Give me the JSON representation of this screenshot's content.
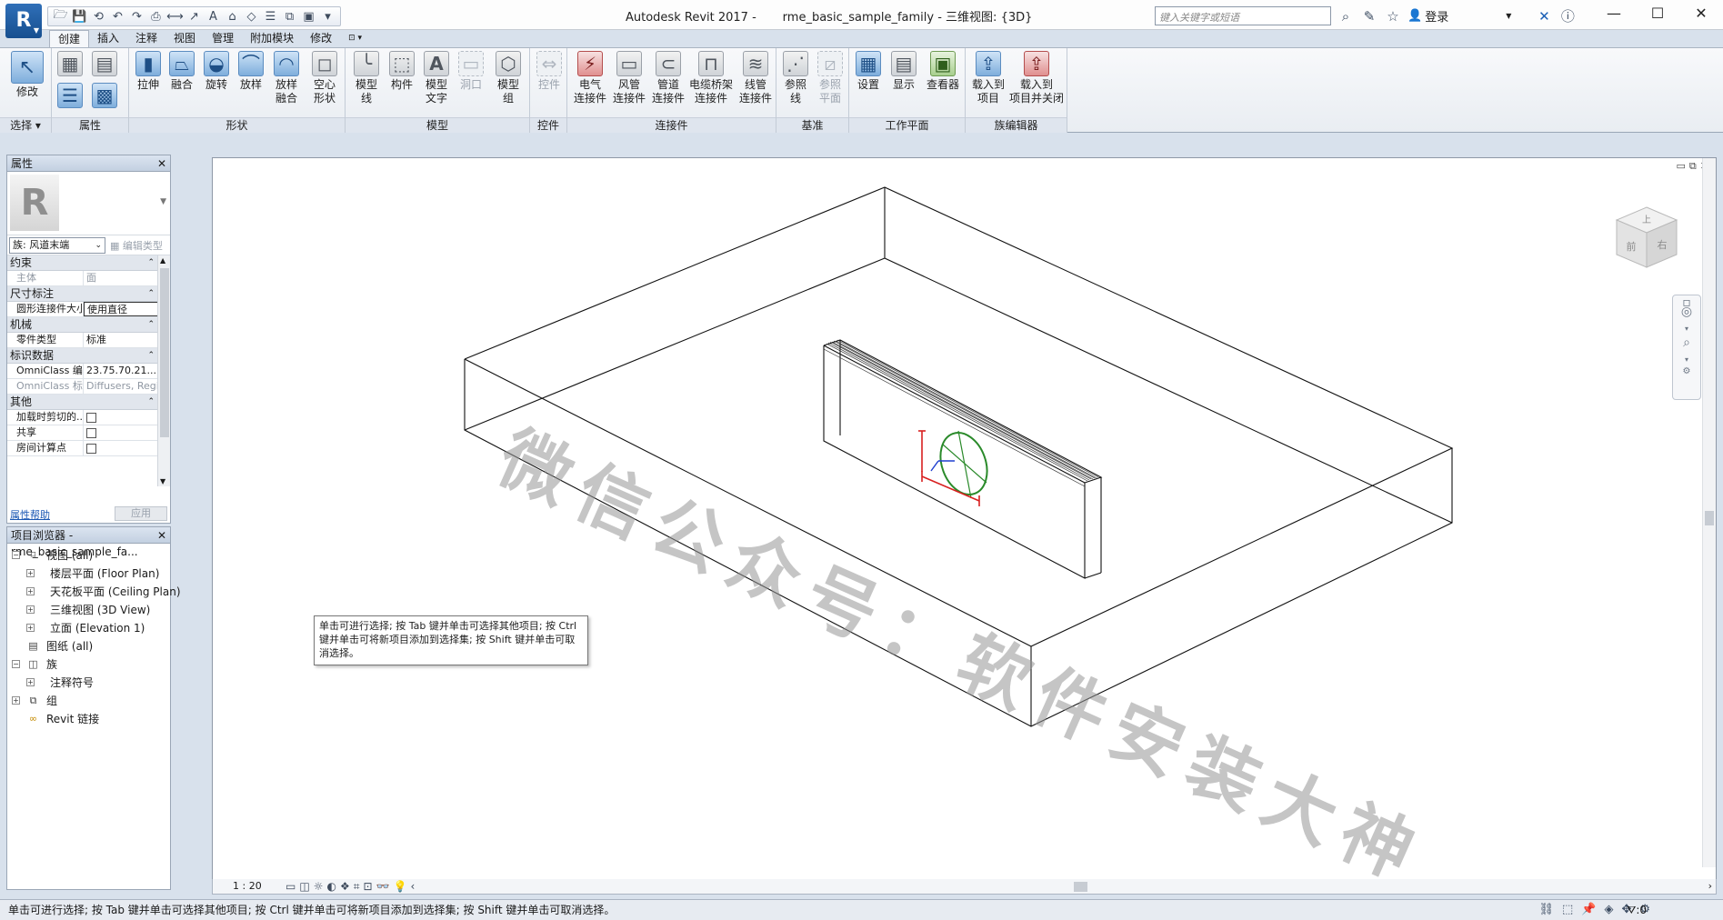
{
  "app": {
    "button_label": "R",
    "window_title": "Autodesk Revit 2017 -       rme_basic_sample_family - 三维视图: {3D}"
  },
  "infocenter": {
    "search_placeholder": "键入关键字或短语",
    "signin": "登录"
  },
  "ribbon": {
    "tabs": [
      "创建",
      "插入",
      "注释",
      "视图",
      "管理",
      "附加模块",
      "修改"
    ],
    "active_tab": "创建",
    "groups": {
      "select": "选择",
      "properties": "属性",
      "forms": "形状",
      "model": "模型",
      "control": "控件",
      "connectors": "连接件",
      "datum": "基准",
      "work_plane": "工作平面",
      "family_editor": "族编辑器"
    },
    "buttons": {
      "modify": "修改",
      "extrusion": "拉伸",
      "blend": "融合",
      "revolve": "旋转",
      "sweep": "放样",
      "swept_blend_1": "放样",
      "swept_blend_2": "融合",
      "void_1": "空心",
      "void_2": "形状",
      "model_line_1": "模型",
      "model_line_2": "线",
      "component": "构件",
      "model_text_1": "模型",
      "model_text_2": "文字",
      "opening": "洞口",
      "model_group_1": "模型",
      "model_group_2": "组",
      "control": "控件",
      "elec_1": "电气",
      "elec_2": "连接件",
      "duct_1": "风管",
      "duct_2": "连接件",
      "pipe_1": "管道",
      "pipe_2": "连接件",
      "cable_1": "电缆桥架",
      "cable_2": "连接件",
      "conduit_1": "线管",
      "conduit_2": "连接件",
      "ref_line_1": "参照",
      "ref_line_2": "线",
      "ref_plane_1": "参照",
      "ref_plane_2": "平面",
      "set": "设置",
      "show": "显示",
      "viewer": "查看器",
      "load_1": "载入到",
      "load_2": "项目",
      "load_close_1": "载入到",
      "load_close_2": "项目并关闭"
    }
  },
  "properties": {
    "title": "属性",
    "logo": "R",
    "family_select": "族: 风道末端",
    "edit_type": "编辑类型",
    "categories": {
      "constraints": "约束",
      "dimensions": "尺寸标注",
      "mechanical": "机械",
      "identity": "标识数据",
      "other": "其他"
    },
    "rows": {
      "host_key": "主体",
      "host_val": "面",
      "round_key": "圆形连接件大小",
      "round_val": "使用直径",
      "part_key": "零件类型",
      "part_val": "标准",
      "omni_num_key": "OmniClass 编号",
      "omni_num_val": "23.75.70.21....",
      "omni_title_key": "OmniClass 标题",
      "omni_title_val": "Diffusers, Regi...",
      "cut_key": "加载时剪切的...",
      "shared_key": "共享",
      "room_key": "房间计算点"
    },
    "help": "属性帮助",
    "apply": "应用"
  },
  "browser": {
    "title": "项目浏览器 - rme_basic_sample_fa...",
    "items": {
      "views": "视图 (all)",
      "floor": "楼层平面 (Floor Plan)",
      "ceiling": "天花板平面 (Ceiling Plan)",
      "threed": "三维视图 (3D View)",
      "elevation": "立面 (Elevation 1)",
      "sheets": "图纸 (all)",
      "families": "族",
      "annotation": "注释符号",
      "groups": "组",
      "links": "Revit 链接"
    }
  },
  "viewport": {
    "watermark": "微信公众号：软件安装大神",
    "viewcube_top": "上",
    "viewcube_front": "前",
    "viewcube_right": "右",
    "tooltip": "单击可进行选择; 按 Tab 键并单击可选择其他项目; 按 Ctrl 键并单击可将新项目添加到选择集; 按 Shift 键并单击可取消选择。"
  },
  "view_control": {
    "scale": "1 : 20"
  },
  "statusbar": {
    "text": "单击可进行选择; 按 Tab 键并单击可选择其他项目; 按 Ctrl 键并单击可将新项目添加到选择集; 按 Shift 键并单击可取消选择。",
    "filter_count": ":0"
  }
}
